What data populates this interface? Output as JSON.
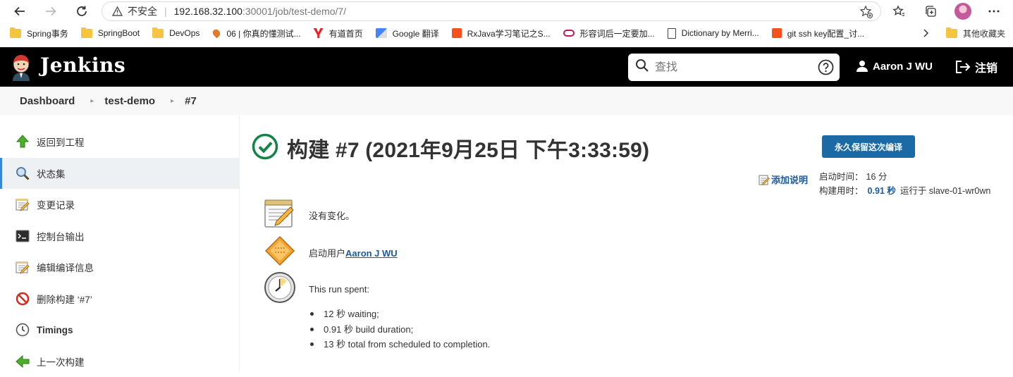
{
  "browser": {
    "insecure_label": "不安全",
    "url_host": "192.168.32.100",
    "url_path": ":30001/job/test-demo/7/",
    "bookmarks": [
      {
        "label": "Spring事务",
        "icon": "folder-icon"
      },
      {
        "label": "SpringBoot",
        "icon": "folder-icon"
      },
      {
        "label": "DevOps",
        "icon": "folder-icon"
      },
      {
        "label": "06 | 你真的懂测试...",
        "icon": "site-icon"
      },
      {
        "label": "有道首页",
        "icon": "youdao-icon"
      },
      {
        "label": "Google 翻译",
        "icon": "google-translate-icon"
      },
      {
        "label": "RxJava学习笔记之S...",
        "icon": "csdn-icon"
      },
      {
        "label": "形容词后一定要加...",
        "icon": "link-icon"
      },
      {
        "label": "Dictionary by Merri...",
        "icon": "page-icon"
      },
      {
        "label": "git ssh key配置_讨...",
        "icon": "csdn-icon"
      }
    ],
    "other_bookmarks": "其他收藏夹"
  },
  "header": {
    "title": "Jenkins",
    "search_placeholder": "查找",
    "user": "Aaron J WU",
    "logout": "注销"
  },
  "breadcrumb": [
    "Dashboard",
    "test-demo",
    "#7"
  ],
  "sidebar": {
    "items": [
      {
        "label": "返回到工程",
        "icon": "up-arrow-icon"
      },
      {
        "label": "状态集",
        "icon": "magnifier-icon",
        "active": true
      },
      {
        "label": "变更记录",
        "icon": "notepad-icon"
      },
      {
        "label": "控制台输出",
        "icon": "terminal-icon"
      },
      {
        "label": "编辑编译信息",
        "icon": "notepad-icon"
      },
      {
        "label": "删除构建 ‘#7’",
        "icon": "no-entry-icon"
      },
      {
        "label": "Timings",
        "icon": "clock-icon"
      },
      {
        "label": "上一次构建",
        "icon": "left-arrow-icon"
      }
    ]
  },
  "main": {
    "build_title": "构建 #7 (2021年9月25日 下午3:33:59)",
    "keep_button": "永久保留这次编译",
    "add_description": "添加说明",
    "started_ago_label": "启动时间：",
    "started_ago_value": "16 分",
    "duration_label": "构建用时：",
    "duration_value": "0.91 秒",
    "ran_on": "运行于 slave-01-wr0wn",
    "no_changes": "没有变化。",
    "started_by_prefix": "启动用户",
    "started_by_user": "Aaron J WU",
    "run_spent": "This run spent:",
    "timings": [
      "12 秒 waiting;",
      "0.91 秒 build duration;",
      "13 秒 total from scheduled to completion."
    ]
  },
  "colors": {
    "accent": "#1b6aa5",
    "success": "#138347",
    "header_bg": "#000000"
  }
}
